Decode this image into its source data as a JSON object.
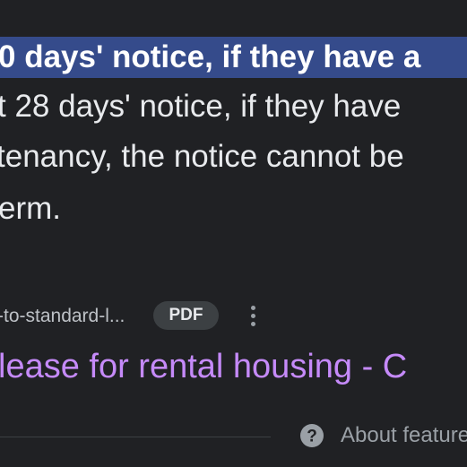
{
  "snippet": {
    "highlighted_line": "0 days' notice, if they have a",
    "line_2": "t 28 days' notice, if they have",
    "line_3": "tenancy, the notice cannot be",
    "line_4": "erm."
  },
  "source": {
    "url_fragment": "-to-standard-l...",
    "file_type_badge": "PDF",
    "menu_icon": "more-vert-icon"
  },
  "result": {
    "title": "lease for rental housing - C"
  },
  "footer": {
    "help_icon": "help-circle-icon",
    "about_label": "About feature"
  },
  "colors": {
    "background": "#202124",
    "highlight": "#354b8b",
    "link": "#c58af9",
    "text": "#e8eaed",
    "muted": "#9aa0a6"
  }
}
